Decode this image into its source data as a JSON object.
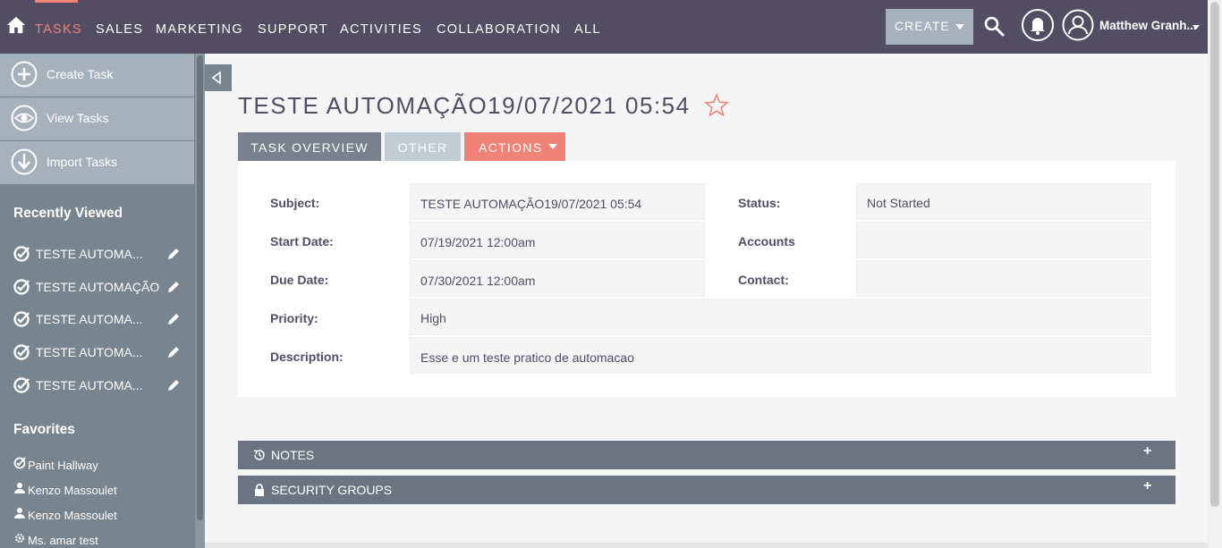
{
  "nav": {
    "items": [
      "TASKS",
      "SALES",
      "MARKETING",
      "SUPPORT",
      "ACTIVITIES",
      "COLLABORATION",
      "ALL"
    ],
    "create_label": "CREATE",
    "user_name": "Matthew Granh...",
    "accent_color": "#f08377",
    "bar_color": "#534d64"
  },
  "sidebar": {
    "actions": [
      {
        "label": "Create Task",
        "icon": "plus-circle-icon"
      },
      {
        "label": "View Tasks",
        "icon": "eye-icon"
      },
      {
        "label": "Import Tasks",
        "icon": "download-icon"
      }
    ],
    "recent_heading": "Recently Viewed",
    "recent": [
      "TESTE AUTOMA...",
      "TESTE AUTOMAÇÃO",
      "TESTE AUTOMA...",
      "TESTE AUTOMA...",
      "TESTE AUTOMA..."
    ],
    "favorites_heading": "Favorites",
    "favorites": [
      {
        "label": "Paint Hallway",
        "icon": "task-icon"
      },
      {
        "label": "Kenzo Massoulet",
        "icon": "person-icon"
      },
      {
        "label": "Kenzo Massoulet",
        "icon": "person-icon"
      },
      {
        "label": "Ms. amar test",
        "icon": "gear-icon"
      }
    ]
  },
  "record": {
    "title": "TESTE AUTOMAÇÃO19/07/2021 05:54",
    "tabs": [
      "TASK OVERVIEW",
      "OTHER",
      "ACTIONS"
    ],
    "fields": {
      "subject_label": "Subject:",
      "subject": "TESTE AUTOMAÇÃO19/07/2021 05:54",
      "status_label": "Status:",
      "status": "Not Started",
      "start_label": "Start Date:",
      "start": "07/19/2021 12:00am",
      "accounts_label": "Accounts",
      "accounts": "",
      "due_label": "Due Date:",
      "due": "07/30/2021 12:00am",
      "contact_label": "Contact:",
      "contact": "",
      "priority_label": "Priority:",
      "priority": "High",
      "description_label": "Description:",
      "description": "Esse e um teste pratico de automacao"
    }
  },
  "subpanels": [
    {
      "label": "NOTES",
      "icon": "history-icon",
      "toggle": "+"
    },
    {
      "label": "SECURITY GROUPS",
      "icon": "lock-icon",
      "toggle": "+"
    }
  ]
}
